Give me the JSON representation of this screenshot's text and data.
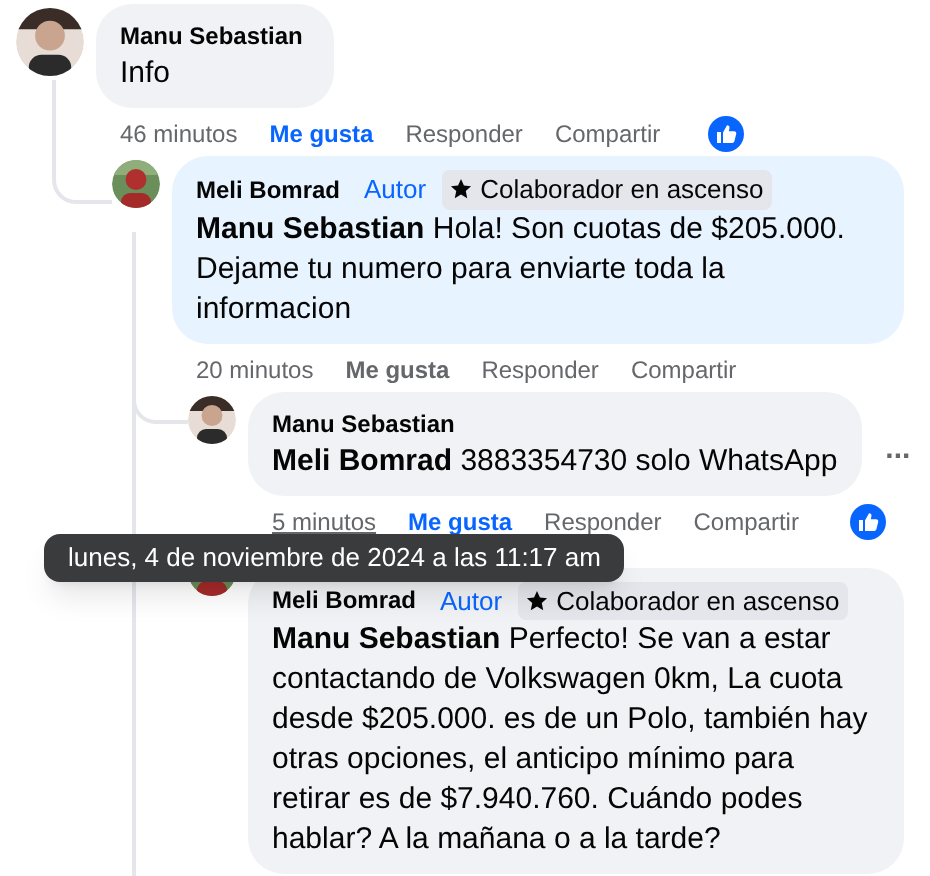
{
  "comments": [
    {
      "author": "Manu Sebastian",
      "text": "Info",
      "time": "46 minutos",
      "time_hovered": false,
      "actions": {
        "like": "Me gusta",
        "reply": "Responder",
        "share": "Compartir"
      },
      "liked": true,
      "reaction": true,
      "children": [
        {
          "author": "Meli Bomrad",
          "badges": [
            {
              "kind": "role",
              "label": "Autor"
            },
            {
              "kind": "star",
              "label": "Colaborador en ascenso"
            }
          ],
          "mention": "Manu Sebastian",
          "text": "Hola! Son cuotas de $205.000. Dejame tu numero para enviarte toda la informacion",
          "time": "20 minutos",
          "time_hovered": false,
          "actions": {
            "like": "Me gusta",
            "reply": "Responder",
            "share": "Compartir"
          },
          "liked": false,
          "reaction": false,
          "children": [
            {
              "author": "Manu Sebastian",
              "mention": "Meli Bomrad",
              "text": "3883354730 solo WhatsApp",
              "time": "5 minutos",
              "time_hovered": true,
              "actions": {
                "like": "Me gusta",
                "reply": "Responder",
                "share": "Compartir"
              },
              "liked": true,
              "reaction": true,
              "menu": "..."
            },
            {
              "author": "Meli Bomrad",
              "badges": [
                {
                  "kind": "role",
                  "label": "Autor"
                },
                {
                  "kind": "star",
                  "label": "Colaborador en ascenso"
                }
              ],
              "mention": "Manu Sebastian",
              "text": "Perfecto! Se van a estar contactando de Volkswagen 0km, La cuota desde $205.000. es de un Polo, también hay otras opciones, el anticipo mínimo para retirar es de $7.940.760. Cuándo podes hablar? A la mañana o a la tarde?"
            }
          ]
        }
      ]
    }
  ],
  "tooltip": {
    "text": "lunes, 4 de noviembre de 2024 a las 11:17 am"
  }
}
